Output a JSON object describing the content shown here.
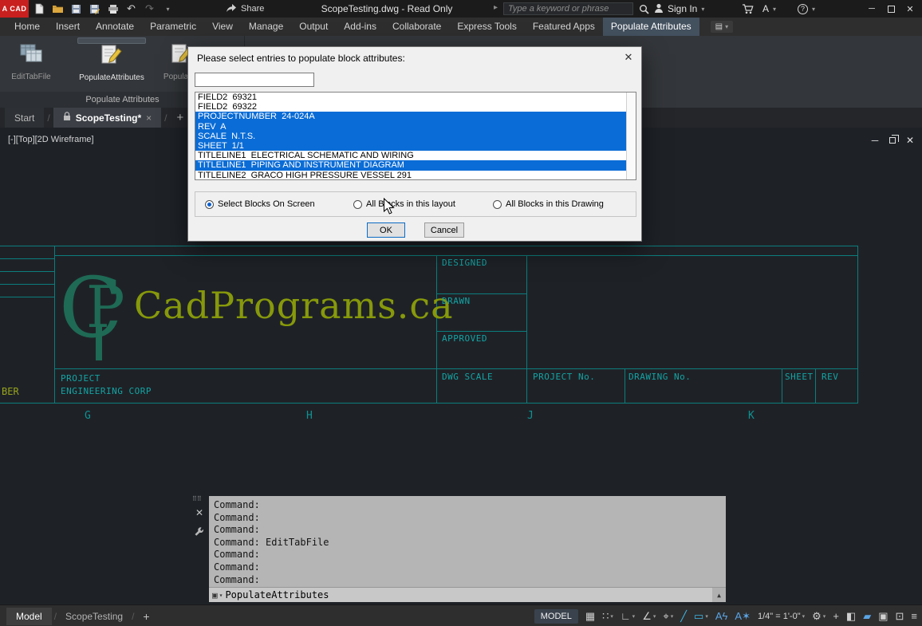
{
  "titlebar": {
    "logo_text": "A CAD",
    "title": "ScopeTesting.dwg - Read Only",
    "share_label": "Share",
    "search_placeholder": "Type a keyword or phrase",
    "sign_in_label": "Sign In",
    "store_label": "A"
  },
  "ribbon": {
    "tabs": [
      {
        "label": "Home"
      },
      {
        "label": "Insert"
      },
      {
        "label": "Annotate"
      },
      {
        "label": "Parametric"
      },
      {
        "label": "View"
      },
      {
        "label": "Manage"
      },
      {
        "label": "Output"
      },
      {
        "label": "Add-ins"
      },
      {
        "label": "Collaborate"
      },
      {
        "label": "Express Tools"
      },
      {
        "label": "Featured Apps"
      },
      {
        "label": "Populate Attributes",
        "active": true
      }
    ],
    "panel": {
      "label": "Populate Attributes",
      "buttons": [
        {
          "label": "EditTabFile"
        },
        {
          "label": "PopulateAttributes"
        },
        {
          "label": "PopulateA"
        }
      ]
    }
  },
  "file_tabs": {
    "start_label": "Start",
    "active_label": "ScopeTesting*",
    "separator": "/",
    "new_tab": "+"
  },
  "viewport": {
    "label": "[-][Top][2D Wireframe]"
  },
  "dialog": {
    "title": "Please select entries to populate block attributes:",
    "filter_value": "",
    "entries": [
      {
        "text": "FIELD2  69321",
        "selected": false
      },
      {
        "text": "FIELD2  69322",
        "selected": false
      },
      {
        "text": "PROJECTNUMBER  24-024A",
        "selected": true
      },
      {
        "text": "REV  A",
        "selected": true
      },
      {
        "text": "SCALE  N.T.S.",
        "selected": true
      },
      {
        "text": "SHEET  1/1",
        "selected": true
      },
      {
        "text": "TITLELINE1  ELECTRICAL SCHEMATIC AND WIRING",
        "selected": false
      },
      {
        "text": "TITLELINE1  PIPING AND INSTRUMENT DIAGRAM",
        "selected": true
      },
      {
        "text": "TITLELINE2  GRACO HIGH PRESSURE VESSEL 291",
        "selected": false
      }
    ],
    "radios": [
      {
        "label": "Select Blocks On Screen",
        "checked": true
      },
      {
        "label": "All Blocks in this layout",
        "checked": false
      },
      {
        "label": "All Blocks in this Drawing",
        "checked": false
      }
    ],
    "ok_label": "OK",
    "cancel_label": "Cancel"
  },
  "drawing": {
    "logo_text": "CadPrograms.ca",
    "designed": "DESIGNED",
    "drawn": "DRAWN",
    "approved": "APPROVED",
    "dwg_scale": "DWG SCALE",
    "project_no": "PROJECT No.",
    "drawing_no": "DRAWING No.",
    "sheet": "SHEET",
    "rev": "REV",
    "project_label": "PROJECT",
    "company": "ENGINEERING CORP",
    "left_edge_text": "BER",
    "grid_letters": [
      "G",
      "H",
      "J",
      "K"
    ]
  },
  "command": {
    "lines": [
      "Command:",
      "Command:",
      "Command:",
      "Command: EditTabFile",
      "Command:",
      "Command:",
      "Command:"
    ],
    "input_value": "PopulateAttributes"
  },
  "statusbar": {
    "model_tab": "Model",
    "layout_tab": "ScopeTesting",
    "separator": "/",
    "new_layout": "+",
    "model_button": "MODEL",
    "scale_text": "1/4\" = 1'-0\""
  },
  "icons": {
    "caret_down": "▾",
    "undo": "↶",
    "redo": "↷",
    "close": "✕",
    "close_small": "×",
    "minimize": "─",
    "search_play": "▸",
    "help": "?",
    "grid": "▦",
    "snap": "∷",
    "isodraft": "∟",
    "autotrack": "∠",
    "osnap": "⌖",
    "polar": "╱",
    "selection_box": "▭",
    "annotation_vis": "Aϟ",
    "annotation_auto": "A✶",
    "gear": "⚙",
    "crosshair": "+",
    "viewport_sq": "◧",
    "performance": "▰",
    "image": "▣",
    "clean_screen": "⊡",
    "menu": "≡",
    "grip_dots": "⠿⠿",
    "scroll_up": "▲",
    "cmd_window": "▣",
    "ribbon_toggle": "▤"
  },
  "colors": {
    "accent_teal": "#0c7d7d",
    "logo_olive": "#87990a",
    "selection_blue": "#0a6cd6",
    "logo_red": "#c8201e"
  }
}
